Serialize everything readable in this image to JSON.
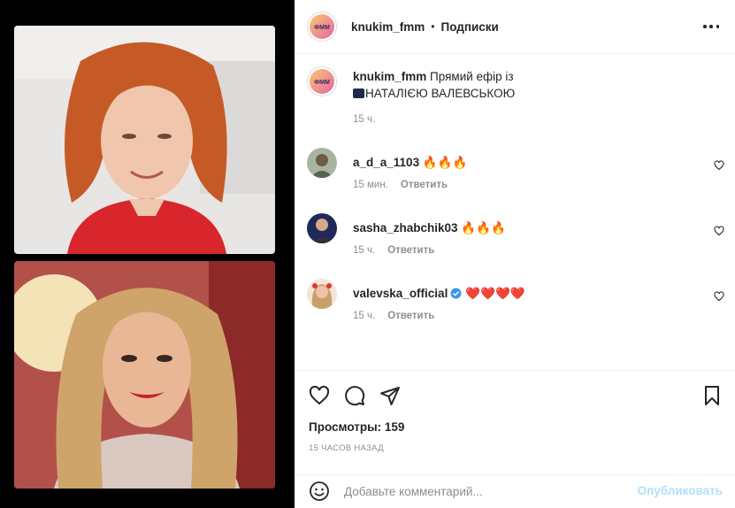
{
  "post": {
    "author": "knukim_fmm",
    "separator": "•",
    "follow_label": "Подписки",
    "caption_author": "knukim_fmm",
    "caption_text": "Прямий ефір із",
    "caption_line2": "НАТАЛІЄЮ ВАЛЕВСЬКОЮ",
    "caption_time": "15 ч."
  },
  "comments": [
    {
      "username": "a_d_a_1103",
      "text": "🔥🔥🔥",
      "time": "15 мин.",
      "reply": "Ответить"
    },
    {
      "username": "sasha_zhabchik03",
      "text": "🔥🔥🔥",
      "time": "15 ч.",
      "reply": "Ответить"
    },
    {
      "username": "valevska_official",
      "text": "❤️❤️❤️❤️",
      "time": "15 ч.",
      "reply": "Ответить",
      "verified": true
    }
  ],
  "stats": {
    "views": "Просмотры: 159",
    "ago": "15 ЧАСОВ НАЗАД"
  },
  "composer": {
    "placeholder": "Добавьте комментарий...",
    "publish": "Опубликовать"
  },
  "icons": {
    "more": "more-horizontal-icon",
    "like": "heart-icon",
    "comment": "comment-bubble-icon",
    "share": "paper-plane-icon",
    "save": "bookmark-icon",
    "emoji": "smiley-icon"
  },
  "colors": {
    "accent_publish": "#b2dffc",
    "verified": "#3897f0",
    "secondary_text": "#8e8e8e"
  }
}
